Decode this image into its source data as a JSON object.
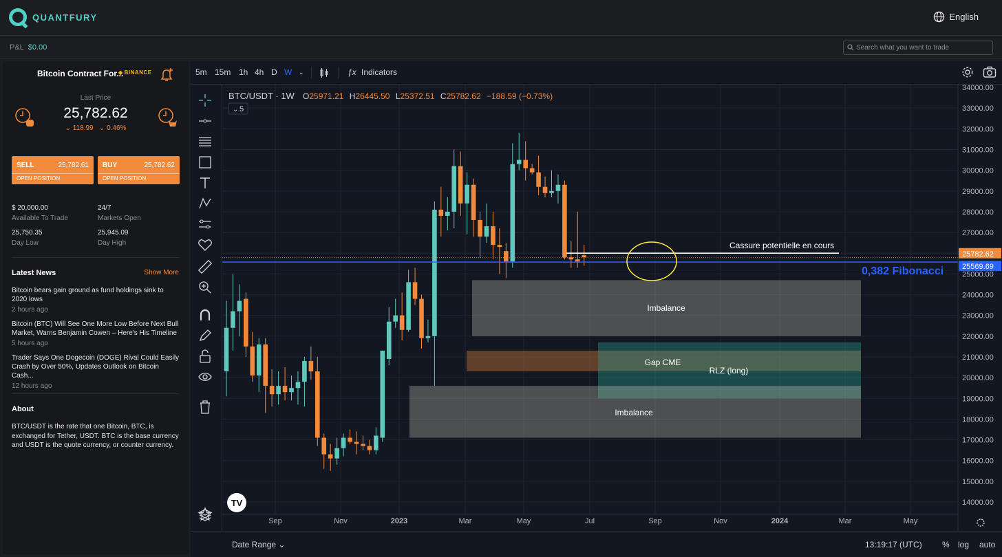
{
  "app": {
    "name": "QUANTFURY",
    "language": "English"
  },
  "subbar": {
    "pnl_label": "P&L",
    "pnl_value": "$0.00",
    "search_placeholder": "Search what you want to trade"
  },
  "instrument": {
    "title": "Bitcoin Contract For...",
    "exchange": "BINANCE",
    "last_price_label": "Last Price",
    "last_price": "25,782.62",
    "change_abs": "118.99",
    "change_pct": "0.46%"
  },
  "trade": {
    "sell_label": "SELL",
    "sell_price": "25,782.61",
    "buy_label": "BUY",
    "buy_price": "25,782.62",
    "open_position": "OPEN POSITION"
  },
  "stats": [
    {
      "value": "$ 20,000.00",
      "label": "Available To Trade"
    },
    {
      "value": "24/7",
      "label": "Markets Open"
    },
    {
      "value": "25,750.35",
      "label": "Day Low"
    },
    {
      "value": "25,945.09",
      "label": "Day High"
    }
  ],
  "news": {
    "title": "Latest News",
    "show_more": "Show More",
    "items": [
      {
        "headline": "Bitcoin bears gain ground as fund holdings sink to 2020 lows",
        "time": "2 hours ago"
      },
      {
        "headline": "Bitcoin (BTC) Will See One More Low Before Next Bull Market, Warns Benjamin Cowen – Here's His Timeline",
        "time": "5 hours ago"
      },
      {
        "headline": "Trader Says One Dogecoin (DOGE) Rival Could Easily Crash by Over 50%, Updates Outlook on Bitcoin Cash...",
        "time": "12 hours ago"
      }
    ]
  },
  "about": {
    "title": "About",
    "text": "BTC/USDT is the rate that one Bitcoin, BTC, is exchanged for Tether, USDT. BTC is the base currency and USDT is the quote currency, or counter currency."
  },
  "chart_toolbar": {
    "intervals": [
      "5m",
      "15m",
      "1h",
      "4h",
      "D",
      "W"
    ],
    "active_interval": "W",
    "indicators": "Indicators"
  },
  "chart_data": {
    "type": "candlestick",
    "symbol": "BTC/USDT · 1W",
    "ohlc": {
      "o_label": "O",
      "o": "25971.21",
      "h_label": "H",
      "h": "26445.50",
      "l_label": "L",
      "l": "25372.51",
      "c_label": "C",
      "c": "25782.62",
      "chg": "−188.59 (−0.73%)"
    },
    "indicator_count": "5",
    "y_ticks": [
      "34000.00",
      "33000.00",
      "32000.00",
      "31000.00",
      "30000.00",
      "29000.00",
      "28000.00",
      "27000.00",
      "26000.00",
      "25000.00",
      "24000.00",
      "23000.00",
      "22000.00",
      "21000.00",
      "20000.00",
      "19000.00",
      "18000.00",
      "17000.00",
      "16000.00",
      "15000.00",
      "14000.00"
    ],
    "x_ticks": [
      "Sep",
      "Nov",
      "2023",
      "Mar",
      "May",
      "Jul",
      "Sep",
      "Nov",
      "2024",
      "Mar",
      "May"
    ],
    "price_labels": [
      {
        "value": "25782.62",
        "color": "#f28a3c"
      },
      {
        "value": "25569.69",
        "color": "#2962ff"
      }
    ],
    "annotations": {
      "breakout": "Cassure potentielle en cours",
      "fib": "0,382 Fibonacci",
      "imb1": "Imbalance",
      "gap": "Gap CME",
      "rlz": "RLZ (long)",
      "imb2": "Imbalance"
    },
    "colors": {
      "up": "#5fc9bd",
      "down": "#f28a3c",
      "fib_line": "#2962ff"
    },
    "candles": [
      [
        20300,
        23700,
        19100,
        22400
      ],
      [
        22400,
        25000,
        21300,
        23200
      ],
      [
        23200,
        24500,
        22000,
        23700
      ],
      [
        23800,
        24100,
        21000,
        21500
      ],
      [
        21500,
        22200,
        19800,
        20100
      ],
      [
        20100,
        21900,
        19300,
        21600
      ],
      [
        21600,
        21900,
        18300,
        19600
      ],
      [
        19600,
        20400,
        18600,
        19200
      ],
      [
        19200,
        20300,
        18700,
        19600
      ],
      [
        19600,
        20500,
        18900,
        19300
      ],
      [
        19300,
        20100,
        18900,
        19500
      ],
      [
        19500,
        20300,
        18700,
        19800
      ],
      [
        19800,
        21000,
        18600,
        20800
      ],
      [
        20800,
        21500,
        19900,
        20300
      ],
      [
        20300,
        21000,
        16700,
        17100
      ],
      [
        17100,
        17300,
        15600,
        16300
      ],
      [
        16300,
        16800,
        15500,
        16100
      ],
      [
        16100,
        17100,
        15800,
        16600
      ],
      [
        16600,
        17300,
        16200,
        17100
      ],
      [
        17100,
        17500,
        16800,
        16900
      ],
      [
        16900,
        17400,
        16300,
        16800
      ],
      [
        16800,
        17200,
        16500,
        16700
      ],
      [
        16700,
        17000,
        16300,
        16500
      ],
      [
        16500,
        17600,
        16300,
        17200
      ],
      [
        17100,
        21000,
        16900,
        21300
      ],
      [
        20900,
        23400,
        20600,
        22700
      ],
      [
        22700,
        23800,
        22400,
        23000
      ],
      [
        23000,
        24100,
        21800,
        22300
      ],
      [
        22300,
        25200,
        22200,
        24600
      ],
      [
        24600,
        25300,
        23500,
        23800
      ],
      [
        23800,
        24000,
        21400,
        21900
      ],
      [
        21900,
        22800,
        21700,
        22000
      ],
      [
        22000,
        28500,
        19600,
        28100
      ],
      [
        28100,
        29200,
        26800,
        27800
      ],
      [
        27800,
        28700,
        27100,
        28000
      ],
      [
        28000,
        31000,
        27200,
        30200
      ],
      [
        30200,
        30900,
        27800,
        28400
      ],
      [
        28400,
        29900,
        26900,
        29300
      ],
      [
        29300,
        29600,
        26800,
        27600
      ],
      [
        27600,
        28000,
        25800,
        26800
      ],
      [
        26800,
        28400,
        26500,
        27300
      ],
      [
        27300,
        28000,
        25700,
        26400
      ],
      [
        26400,
        27200,
        25000,
        26300
      ],
      [
        26100,
        26500,
        24800,
        25600
      ],
      [
        25600,
        31300,
        25300,
        30300
      ],
      [
        30300,
        31800,
        30000,
        30500
      ],
      [
        30500,
        31400,
        29500,
        30100
      ],
      [
        30100,
        30300,
        29800,
        29900
      ],
      [
        29900,
        30700,
        28800,
        29200
      ],
      [
        29200,
        29700,
        28700,
        28900
      ],
      [
        28900,
        30000,
        28700,
        29000
      ],
      [
        29000,
        29800,
        28400,
        29300
      ],
      [
        29300,
        29500,
        25700,
        25800
      ],
      [
        25800,
        26600,
        25300,
        25700
      ],
      [
        25700,
        28000,
        25300,
        25600
      ],
      [
        25900,
        26400,
        25400,
        25800
      ]
    ]
  }
}
